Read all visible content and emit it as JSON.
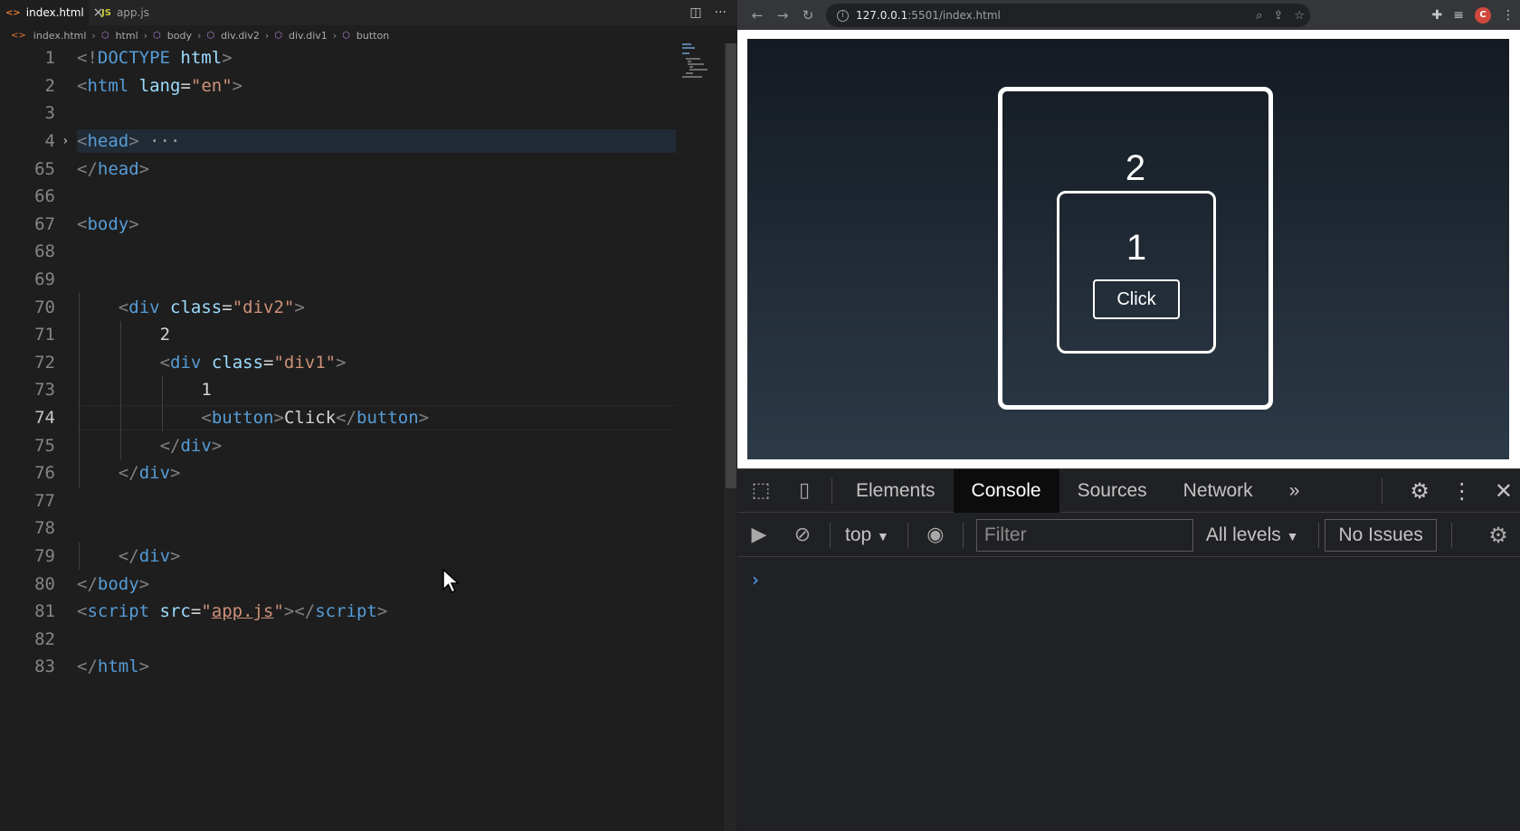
{
  "editor": {
    "tabs": [
      {
        "icon": "<>",
        "label": "index.html",
        "close": "×"
      },
      {
        "icon": "JS",
        "label": "app.js"
      }
    ],
    "breadcrumb": [
      "index.html",
      "html",
      "body",
      "div.div2",
      "div.div1",
      "button"
    ],
    "lines": [
      {
        "n": "1",
        "parts": [
          [
            "t-br",
            "<!"
          ],
          [
            "t-tag",
            "DOCTYPE"
          ],
          [
            "t-txt",
            " "
          ],
          [
            "t-attr",
            "html"
          ],
          [
            "t-br",
            ">"
          ]
        ]
      },
      {
        "n": "2",
        "parts": [
          [
            "t-br",
            "<"
          ],
          [
            "t-tag",
            "html"
          ],
          [
            "t-txt",
            " "
          ],
          [
            "t-attr",
            "lang"
          ],
          [
            "t-txt",
            "="
          ],
          [
            "t-str",
            "\"en\""
          ],
          [
            "t-br",
            ">"
          ]
        ]
      },
      {
        "n": "3",
        "parts": []
      },
      {
        "n": "4",
        "fold": "›",
        "highlight": true,
        "parts": [
          [
            "t-br",
            "<"
          ],
          [
            "t-tag",
            "head"
          ],
          [
            "t-br",
            ">"
          ],
          [
            "t-ell",
            " ···"
          ]
        ]
      },
      {
        "n": "65",
        "parts": [
          [
            "t-br",
            "</"
          ],
          [
            "t-tag",
            "head"
          ],
          [
            "t-br",
            ">"
          ]
        ]
      },
      {
        "n": "66",
        "parts": []
      },
      {
        "n": "67",
        "parts": [
          [
            "t-br",
            "<"
          ],
          [
            "t-tag",
            "body"
          ],
          [
            "t-br",
            ">"
          ]
        ]
      },
      {
        "n": "68",
        "parts": []
      },
      {
        "n": "69",
        "parts": []
      },
      {
        "n": "70",
        "indent": 4,
        "parts": [
          [
            "t-br",
            "<"
          ],
          [
            "t-tag",
            "div"
          ],
          [
            "t-txt",
            " "
          ],
          [
            "t-attr",
            "class"
          ],
          [
            "t-txt",
            "="
          ],
          [
            "t-str",
            "\"div2\""
          ],
          [
            "t-br",
            ">"
          ]
        ]
      },
      {
        "n": "71",
        "indent": 8,
        "parts": [
          [
            "t-txt",
            "2"
          ]
        ]
      },
      {
        "n": "72",
        "indent": 8,
        "parts": [
          [
            "t-br",
            "<"
          ],
          [
            "t-tag",
            "div"
          ],
          [
            "t-txt",
            " "
          ],
          [
            "t-attr",
            "class"
          ],
          [
            "t-txt",
            "="
          ],
          [
            "t-str",
            "\"div1\""
          ],
          [
            "t-br",
            ">"
          ]
        ]
      },
      {
        "n": "73",
        "indent": 12,
        "parts": [
          [
            "t-txt",
            "1"
          ]
        ]
      },
      {
        "n": "74",
        "indent": 12,
        "current": true,
        "parts": [
          [
            "t-br",
            "<"
          ],
          [
            "t-tag",
            "button"
          ],
          [
            "t-br",
            ">"
          ],
          [
            "t-txt",
            "Click"
          ],
          [
            "t-br",
            "</"
          ],
          [
            "t-tag",
            "button"
          ],
          [
            "t-br",
            ">"
          ]
        ]
      },
      {
        "n": "75",
        "indent": 8,
        "parts": [
          [
            "t-br",
            "</"
          ],
          [
            "t-tag",
            "div"
          ],
          [
            "t-br",
            ">"
          ]
        ]
      },
      {
        "n": "76",
        "indent": 4,
        "parts": [
          [
            "t-br",
            "</"
          ],
          [
            "t-tag",
            "div"
          ],
          [
            "t-br",
            ">"
          ]
        ]
      },
      {
        "n": "77",
        "parts": []
      },
      {
        "n": "78",
        "parts": []
      },
      {
        "n": "79",
        "indent": 4,
        "parts": [
          [
            "t-br",
            "</"
          ],
          [
            "t-tag",
            "div"
          ],
          [
            "t-br",
            ">"
          ]
        ]
      },
      {
        "n": "80",
        "parts": [
          [
            "t-br",
            "</"
          ],
          [
            "t-tag",
            "body"
          ],
          [
            "t-br",
            ">"
          ]
        ]
      },
      {
        "n": "81",
        "parts": [
          [
            "t-br",
            "<"
          ],
          [
            "t-tag",
            "script"
          ],
          [
            "t-txt",
            " "
          ],
          [
            "t-attr",
            "src"
          ],
          [
            "t-txt",
            "="
          ],
          [
            "t-str",
            "\""
          ],
          [
            "t-link",
            "app.js"
          ],
          [
            "t-str",
            "\""
          ],
          [
            "t-br",
            "></"
          ],
          [
            "t-tag",
            "script"
          ],
          [
            "t-br",
            ">"
          ]
        ]
      },
      {
        "n": "82",
        "parts": []
      },
      {
        "n": "83",
        "parts": [
          [
            "t-br",
            "</"
          ],
          [
            "t-tag",
            "html"
          ],
          [
            "t-br",
            ">"
          ]
        ]
      }
    ]
  },
  "browser": {
    "url_host": "127.0.0.1",
    "url_path": ":5501/index.html",
    "avatar_letter": "C",
    "page": {
      "outer_number": "2",
      "inner_number": "1",
      "button_label": "Click"
    },
    "devtools": {
      "tabs": [
        "Elements",
        "Console",
        "Sources",
        "Network"
      ],
      "active_tab": "Console",
      "more": "»",
      "context": "top",
      "filter_placeholder": "Filter",
      "levels": "All levels",
      "issues": "No Issues",
      "prompt": "›"
    }
  },
  "colors": {
    "editor_bg": "#1e1e1e",
    "tag": "#569cd6",
    "attr": "#9cdcfe",
    "string": "#ce9178",
    "devtools_bg": "#202124"
  }
}
